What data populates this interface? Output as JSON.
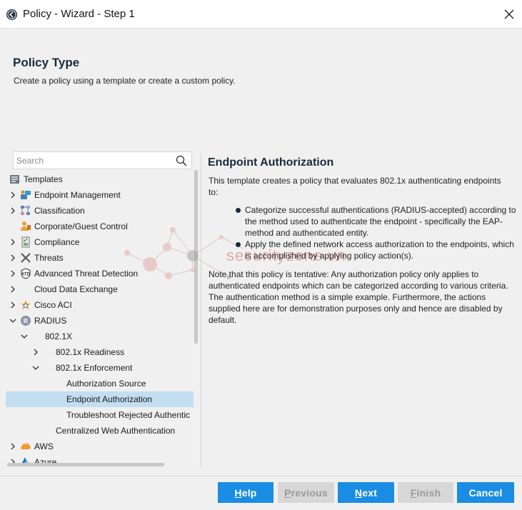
{
  "window": {
    "title": "Policy - Wizard - Step 1"
  },
  "header": {
    "title": "Policy Type",
    "subtitle": "Create a policy using a template or create a custom policy."
  },
  "search": {
    "placeholder": "Search",
    "value": ""
  },
  "tree": {
    "items": [
      {
        "label": "Templates",
        "icon": "templates-icon",
        "expander": "none"
      },
      {
        "label": "Endpoint Management",
        "icon": "endpoint-management-icon",
        "expander": "collapsed"
      },
      {
        "label": "Classification",
        "icon": "classification-icon",
        "expander": "collapsed"
      },
      {
        "label": "Corporate/Guest Control",
        "icon": "guest-control-icon",
        "expander": "none"
      },
      {
        "label": "Compliance",
        "icon": "compliance-icon",
        "expander": "collapsed"
      },
      {
        "label": "Threats",
        "icon": "threats-icon",
        "expander": "collapsed"
      },
      {
        "label": "Advanced Threat Detection",
        "icon": "atd-icon",
        "expander": "collapsed"
      },
      {
        "label": "Cloud Data Exchange",
        "icon": "",
        "expander": "collapsed"
      },
      {
        "label": "Cisco ACI",
        "icon": "cisco-aci-icon",
        "expander": "collapsed"
      },
      {
        "label": "RADIUS",
        "icon": "radius-icon",
        "expander": "expanded"
      },
      {
        "label": "802.1X",
        "icon": "",
        "expander": "expanded"
      },
      {
        "label": "802.1x Readiness",
        "icon": "",
        "expander": "collapsed"
      },
      {
        "label": "802.1x Enforcement",
        "icon": "",
        "expander": "expanded"
      },
      {
        "label": "Authorization Source",
        "icon": "",
        "expander": "none"
      },
      {
        "label": "Endpoint Authorization",
        "icon": "",
        "expander": "none",
        "selected": true
      },
      {
        "label": "Troubleshoot Rejected Authentic",
        "icon": "",
        "expander": "none"
      },
      {
        "label": "Centralized Web Authentication",
        "icon": "",
        "expander": "none"
      },
      {
        "label": "AWS",
        "icon": "aws-icon",
        "expander": "collapsed"
      },
      {
        "label": "Azure",
        "icon": "azure-icon",
        "expander": "collapsed"
      }
    ]
  },
  "description": {
    "title": "Endpoint Authorization",
    "intro": "This template creates a policy that evaluates 802.1x authenticating endpoints to:",
    "bullets": [
      "Categorize successful authentications (RADIUS-accepted) according to the method used to authenticate the endpoint - specifically the EAP-method and authenticated entity.",
      "Apply the defined network access authorization to the endpoints, which is accomplished by applying policy action(s)."
    ],
    "note": "Note that this policy is tentative: Any authorization policy only applies to authenticated endpoints which can be categorized according to various criteria. The authentication method is a simple example. Furthermore, the actions supplied here are for demonstration purposes only and hence are disabled by default."
  },
  "watermark": {
    "text": "securityzone.vn"
  },
  "footer": {
    "help": {
      "prefix": "H",
      "rest": "elp"
    },
    "previous": {
      "prefix": "P",
      "rest": "revious"
    },
    "next": {
      "prefix": "N",
      "rest": "ext"
    },
    "finish": {
      "prefix": "F",
      "rest": "inish"
    },
    "cancel": "Cancel"
  },
  "colors": {
    "accent": "#1b8ce3",
    "selected_row": "#c3def1",
    "heading": "#1a2a3a",
    "disabled": "#d7d7d7"
  }
}
